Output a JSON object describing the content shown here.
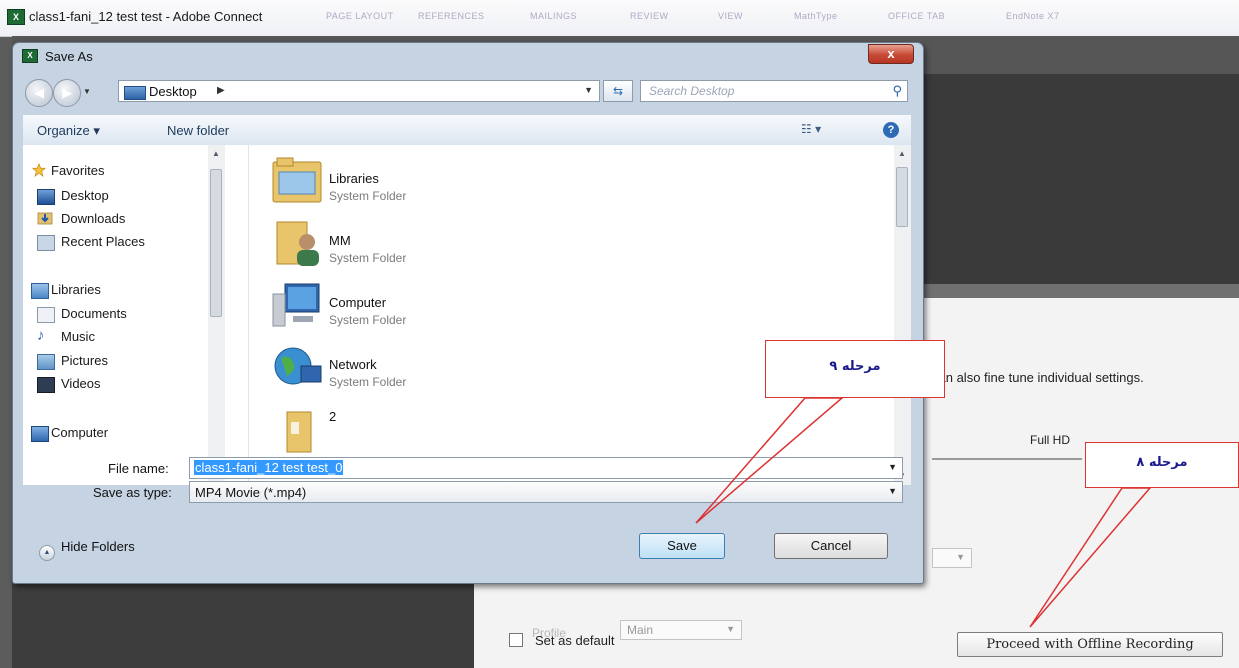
{
  "window": {
    "title": "class1-fani_12 test test - Adobe Connect",
    "icon_label": "X",
    "ribbon_tabs": [
      "PAGE LAYOUT",
      "REFERENCES",
      "MAILINGS",
      "REVIEW",
      "VIEW",
      "MathType",
      "OFFICE TAB",
      "EndNote X7"
    ]
  },
  "recording_panel": {
    "info_text": "can also fine tune individual settings.",
    "quality_label": "Full HD",
    "profile_label": "Profile",
    "profile_value": "Main",
    "set_default_label": "Set as default",
    "proceed_button": "Proceed with Offline Recording"
  },
  "dialog": {
    "title": "Save As",
    "close_glyph": "x",
    "address": {
      "location": "Desktop",
      "crumb_arrow": "▶",
      "dropdown_arrow": "▼"
    },
    "refresh_glyph": "⇆",
    "search_placeholder": "Search Desktop",
    "toolbar": {
      "organize": "Organize ▾",
      "new_folder": "New folder",
      "view": "☷ ▾",
      "help": "?"
    },
    "nav_pane": {
      "items": [
        {
          "label": "Favorites",
          "icon": "star-icon"
        },
        {
          "label": "Desktop",
          "icon": "desktop-icon"
        },
        {
          "label": "Downloads",
          "icon": "downloads-icon"
        },
        {
          "label": "Recent Places",
          "icon": "recent-places-icon"
        },
        {
          "label": "Libraries",
          "icon": "libraries-icon"
        },
        {
          "label": "Documents",
          "icon": "documents-icon"
        },
        {
          "label": "Music",
          "icon": "music-icon"
        },
        {
          "label": "Pictures",
          "icon": "pictures-icon"
        },
        {
          "label": "Videos",
          "icon": "videos-icon"
        },
        {
          "label": "Computer",
          "icon": "computer-icon"
        }
      ]
    },
    "files": [
      {
        "name": "Libraries",
        "type": "System Folder",
        "icon": "libraries-folder-icon"
      },
      {
        "name": "MM",
        "type": "System Folder",
        "icon": "user-folder-icon"
      },
      {
        "name": "Computer",
        "type": "System Folder",
        "icon": "computer-icon"
      },
      {
        "name": "Network",
        "type": "System Folder",
        "icon": "network-icon"
      },
      {
        "name": "2",
        "type": "",
        "icon": "folder-icon"
      }
    ],
    "file_name_label": "File name:",
    "file_name_value": "class1-fani_12 test test_0",
    "save_type_label": "Save as type:",
    "save_type_value": "MP4 Movie (*.mp4)",
    "hide_folders": "Hide Folders",
    "save_button": "Save",
    "cancel_button": "Cancel"
  },
  "callouts": {
    "step9": "مرحله ۹",
    "step8": "مرحله ۸"
  },
  "colors": {
    "callout_border": "#dd3333",
    "callout_text": "#1a1a8a",
    "selection": "#3399ff"
  }
}
